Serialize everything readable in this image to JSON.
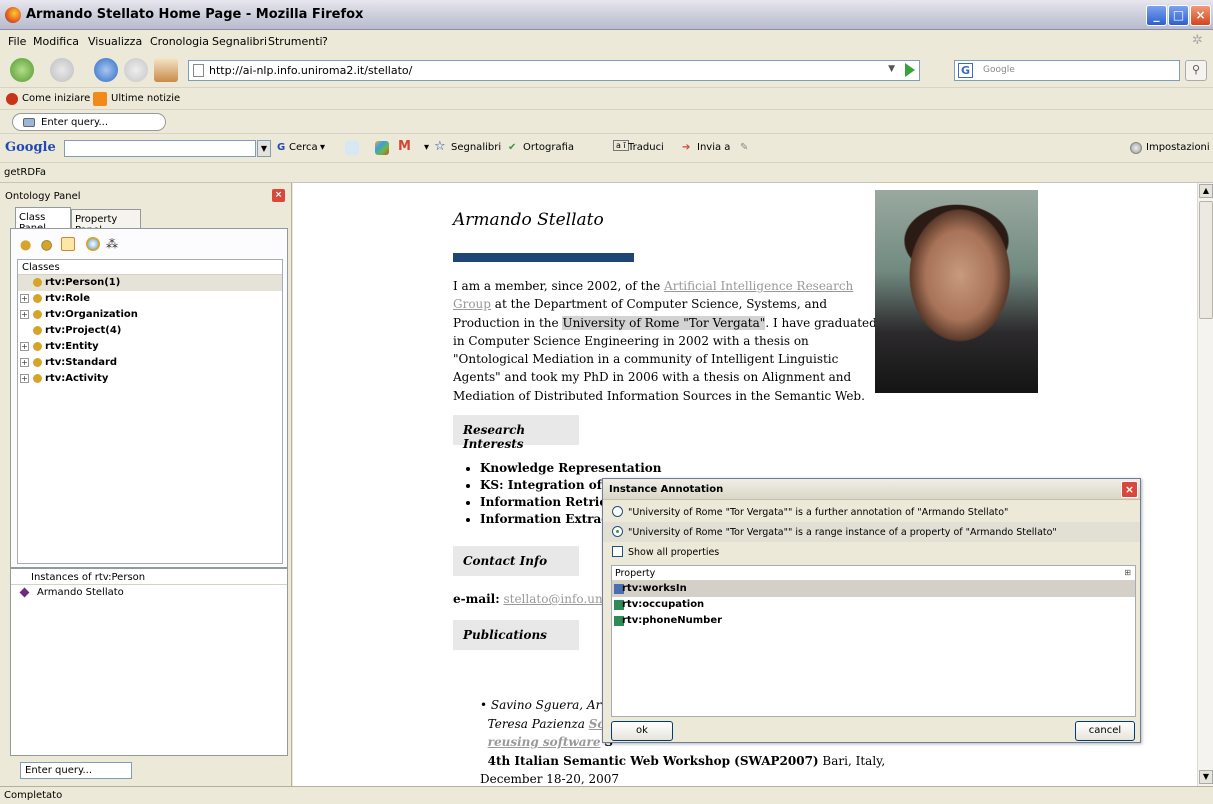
{
  "window": {
    "title": "Armando Stellato Home Page - Mozilla Firefox"
  },
  "menu": [
    "File",
    "Modifica",
    "Visualizza",
    "Cronologia",
    "Segnalibri",
    "Strumenti",
    "?"
  ],
  "nav": {
    "url": "http://ai-nlp.info.uniroma2.it/stellato/",
    "search_placeholder": "Google"
  },
  "bookmarks": [
    "Come iniziare",
    "Ultime notizie"
  ],
  "query_bar": {
    "placeholder": "Enter query..."
  },
  "google_toolbar": {
    "logo": "Google",
    "items": [
      "Cerca",
      "Segnalibri",
      "Ortografia",
      "Traduci",
      "Invia a",
      "Impostazioni"
    ]
  },
  "rdfa_bar": {
    "label": "getRDFa"
  },
  "ontology_panel": {
    "title": "Ontology Panel",
    "tabs": [
      "Class Panel",
      "Property Panel"
    ],
    "classes_header": "Classes",
    "classes": [
      {
        "label": "rtv:Person(1)",
        "expandable": false,
        "selected": true
      },
      {
        "label": "rtv:Role",
        "expandable": true,
        "selected": false
      },
      {
        "label": "rtv:Organization",
        "expandable": true,
        "selected": false
      },
      {
        "label": "rtv:Project(4)",
        "expandable": false,
        "selected": false
      },
      {
        "label": "rtv:Entity",
        "expandable": true,
        "selected": false
      },
      {
        "label": "rtv:Standard",
        "expandable": true,
        "selected": false
      },
      {
        "label": "rtv:Activity",
        "expandable": true,
        "selected": false
      }
    ],
    "instances_header": "Instances of rtv:Person",
    "instances": [
      "Armando Stellato"
    ],
    "query_placeholder": "Enter query..."
  },
  "page": {
    "name": "Armando Stellato",
    "intro_1": "I am a member, since 2002, of the ",
    "intro_link": "Artificial Intelligence Research Group",
    "intro_2": " at the Department of Computer Science, Systems, and Production in the ",
    "intro_highlight": "University of Rome \"Tor Vergata\"",
    "intro_3": ". I have graduated in Computer Science Engineering in 2002 with a thesis on \"Ontological Mediation in a community of Intelligent Linguistic Agents\" and took my PhD in 2006 with a thesis on Alignment and Mediation of Distributed Information Sources in the Semantic Web.",
    "research_header": "Research Interests",
    "interests": [
      "Knowledge Representation",
      "KS: Integration of",
      "Information Retrie",
      "Information Extrac"
    ],
    "contact_header": "Contact Info",
    "email_label": "e-mail:",
    "email_value": "stellato@info.uniror",
    "publications_header": "Publications",
    "pub_authors_1": "Savino Sguera, Arm",
    "pub_authors_2": "Teresa Pazienza",
    "pub_title_1": "So",
    "pub_title_2": "reusing software",
    "pub_venue_1": "S",
    "pub_venue_2": "4th Italian Semantic Web Workshop (SWAP2007)",
    "pub_place": " Bari, Italy, December 18-20, 2007"
  },
  "dialog": {
    "title": "Instance Annotation",
    "option_1": "\"University of Rome \"Tor Vergata\"\" is a further annotation of \"Armando Stellato\"",
    "option_2": "\"University of Rome \"Tor Vergata\"\" is a range instance of a property of \"Armando Stellato\"",
    "option_selected": 2,
    "show_all": "Show all properties",
    "property_header": "Property",
    "properties": [
      {
        "label": "rtv:worksIn",
        "color": "#4a6fb0",
        "selected": true
      },
      {
        "label": "rtv:occupation",
        "color": "#2e8b57",
        "selected": false
      },
      {
        "label": "rtv:phoneNumber",
        "color": "#2e8b57",
        "selected": false
      }
    ],
    "ok": "ok",
    "cancel": "cancel"
  },
  "status": {
    "text": "Completato"
  }
}
